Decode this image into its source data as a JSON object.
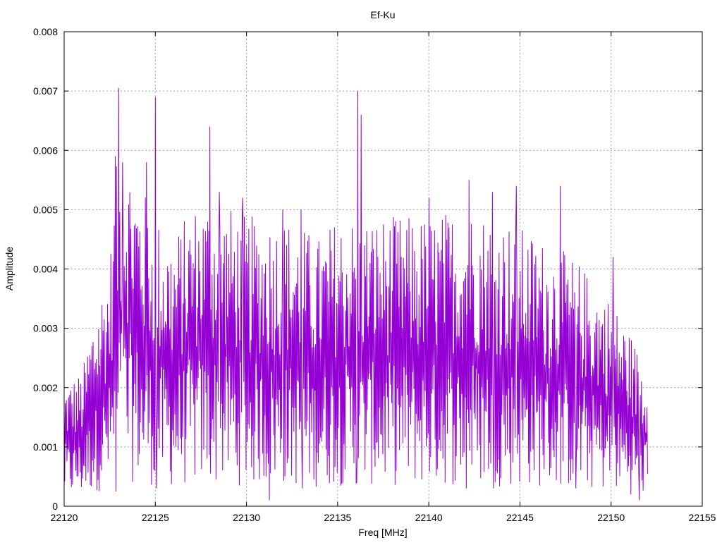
{
  "chart_data": {
    "type": "line",
    "title": "Ef-Ku",
    "xlabel": "Freq [MHz]",
    "ylabel": "Amplitude",
    "xlim": [
      22120,
      22155
    ],
    "ylim": [
      0,
      0.008
    ],
    "x_ticks": [
      "22120",
      "22125",
      "22130",
      "22135",
      "22140",
      "22145",
      "22150",
      "22155"
    ],
    "y_ticks": [
      "0",
      "0.001",
      "0.002",
      "0.003",
      "0.004",
      "0.005",
      "0.006",
      "0.007",
      "0.008"
    ],
    "grid": true,
    "line_color": "#9400d3",
    "series": [
      {
        "x_start": 22120,
        "x_end": 22152,
        "approx_points": 1050,
        "shape": "dense noisy spectrum",
        "envelope": [
          [
            22120,
            0.0012
          ],
          [
            22121,
            0.0013
          ],
          [
            22121.5,
            0.0018
          ],
          [
            22122.5,
            0.0024
          ],
          [
            22123,
            0.0036
          ],
          [
            22124,
            0.0032
          ],
          [
            22125,
            0.0028
          ],
          [
            22126,
            0.0026
          ],
          [
            22127,
            0.0029
          ],
          [
            22128,
            0.003
          ],
          [
            22130,
            0.0028
          ],
          [
            22132,
            0.0028
          ],
          [
            22134,
            0.0026
          ],
          [
            22135,
            0.0028
          ],
          [
            22136,
            0.0028
          ],
          [
            22138,
            0.0028
          ],
          [
            22140,
            0.0028
          ],
          [
            22142,
            0.0029
          ],
          [
            22144,
            0.0028
          ],
          [
            22146,
            0.0026
          ],
          [
            22148,
            0.0024
          ],
          [
            22150,
            0.002
          ],
          [
            22151,
            0.0017
          ],
          [
            22152,
            0.0013
          ]
        ],
        "peaks": [
          [
            22123.0,
            0.00705
          ],
          [
            22123.2,
            0.0058
          ],
          [
            22122.8,
            0.0059
          ],
          [
            22125.0,
            0.0069
          ],
          [
            22124.5,
            0.0058
          ],
          [
            22128.0,
            0.0064
          ],
          [
            22128.5,
            0.0053
          ],
          [
            22129.8,
            0.0052
          ],
          [
            22132.0,
            0.005
          ],
          [
            22133.0,
            0.005
          ],
          [
            22136.1,
            0.007
          ],
          [
            22136.3,
            0.0066
          ],
          [
            22140.0,
            0.0052
          ],
          [
            22142.2,
            0.0055
          ],
          [
            22143.5,
            0.0053
          ],
          [
            22144.8,
            0.0054
          ],
          [
            22147.2,
            0.0054
          ],
          [
            22150.1,
            0.0042
          ]
        ],
        "dips": [
          [
            22122.8,
            0.00025
          ],
          [
            22125,
            0.0003
          ],
          [
            22131.2,
            0.0001
          ],
          [
            22133,
            0.0003
          ],
          [
            22136,
            0.0004
          ],
          [
            22142,
            0.0003
          ],
          [
            22143.5,
            0.0003
          ],
          [
            22148,
            0.0003
          ],
          [
            22151.5,
            0.0001
          ]
        ]
      }
    ]
  }
}
